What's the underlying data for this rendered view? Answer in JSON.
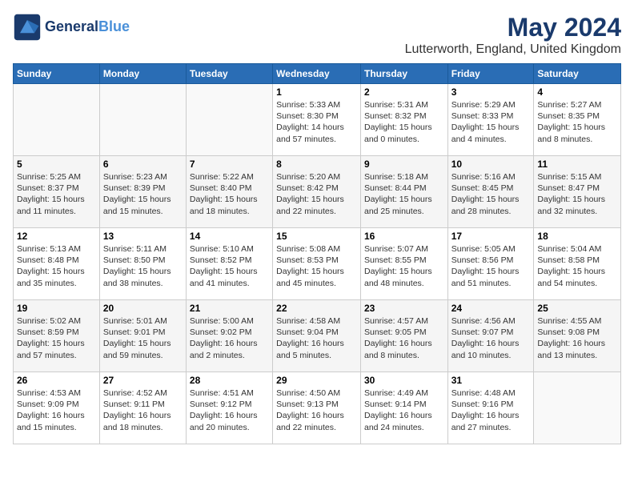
{
  "header": {
    "logo_line1": "General",
    "logo_line2": "Blue",
    "month_title": "May 2024",
    "location": "Lutterworth, England, United Kingdom"
  },
  "days_of_week": [
    "Sunday",
    "Monday",
    "Tuesday",
    "Wednesday",
    "Thursday",
    "Friday",
    "Saturday"
  ],
  "weeks": [
    [
      {
        "day": "",
        "info": ""
      },
      {
        "day": "",
        "info": ""
      },
      {
        "day": "",
        "info": ""
      },
      {
        "day": "1",
        "info": "Sunrise: 5:33 AM\nSunset: 8:30 PM\nDaylight: 14 hours\nand 57 minutes."
      },
      {
        "day": "2",
        "info": "Sunrise: 5:31 AM\nSunset: 8:32 PM\nDaylight: 15 hours\nand 0 minutes."
      },
      {
        "day": "3",
        "info": "Sunrise: 5:29 AM\nSunset: 8:33 PM\nDaylight: 15 hours\nand 4 minutes."
      },
      {
        "day": "4",
        "info": "Sunrise: 5:27 AM\nSunset: 8:35 PM\nDaylight: 15 hours\nand 8 minutes."
      }
    ],
    [
      {
        "day": "5",
        "info": "Sunrise: 5:25 AM\nSunset: 8:37 PM\nDaylight: 15 hours\nand 11 minutes."
      },
      {
        "day": "6",
        "info": "Sunrise: 5:23 AM\nSunset: 8:39 PM\nDaylight: 15 hours\nand 15 minutes."
      },
      {
        "day": "7",
        "info": "Sunrise: 5:22 AM\nSunset: 8:40 PM\nDaylight: 15 hours\nand 18 minutes."
      },
      {
        "day": "8",
        "info": "Sunrise: 5:20 AM\nSunset: 8:42 PM\nDaylight: 15 hours\nand 22 minutes."
      },
      {
        "day": "9",
        "info": "Sunrise: 5:18 AM\nSunset: 8:44 PM\nDaylight: 15 hours\nand 25 minutes."
      },
      {
        "day": "10",
        "info": "Sunrise: 5:16 AM\nSunset: 8:45 PM\nDaylight: 15 hours\nand 28 minutes."
      },
      {
        "day": "11",
        "info": "Sunrise: 5:15 AM\nSunset: 8:47 PM\nDaylight: 15 hours\nand 32 minutes."
      }
    ],
    [
      {
        "day": "12",
        "info": "Sunrise: 5:13 AM\nSunset: 8:48 PM\nDaylight: 15 hours\nand 35 minutes."
      },
      {
        "day": "13",
        "info": "Sunrise: 5:11 AM\nSunset: 8:50 PM\nDaylight: 15 hours\nand 38 minutes."
      },
      {
        "day": "14",
        "info": "Sunrise: 5:10 AM\nSunset: 8:52 PM\nDaylight: 15 hours\nand 41 minutes."
      },
      {
        "day": "15",
        "info": "Sunrise: 5:08 AM\nSunset: 8:53 PM\nDaylight: 15 hours\nand 45 minutes."
      },
      {
        "day": "16",
        "info": "Sunrise: 5:07 AM\nSunset: 8:55 PM\nDaylight: 15 hours\nand 48 minutes."
      },
      {
        "day": "17",
        "info": "Sunrise: 5:05 AM\nSunset: 8:56 PM\nDaylight: 15 hours\nand 51 minutes."
      },
      {
        "day": "18",
        "info": "Sunrise: 5:04 AM\nSunset: 8:58 PM\nDaylight: 15 hours\nand 54 minutes."
      }
    ],
    [
      {
        "day": "19",
        "info": "Sunrise: 5:02 AM\nSunset: 8:59 PM\nDaylight: 15 hours\nand 57 minutes."
      },
      {
        "day": "20",
        "info": "Sunrise: 5:01 AM\nSunset: 9:01 PM\nDaylight: 15 hours\nand 59 minutes."
      },
      {
        "day": "21",
        "info": "Sunrise: 5:00 AM\nSunset: 9:02 PM\nDaylight: 16 hours\nand 2 minutes."
      },
      {
        "day": "22",
        "info": "Sunrise: 4:58 AM\nSunset: 9:04 PM\nDaylight: 16 hours\nand 5 minutes."
      },
      {
        "day": "23",
        "info": "Sunrise: 4:57 AM\nSunset: 9:05 PM\nDaylight: 16 hours\nand 8 minutes."
      },
      {
        "day": "24",
        "info": "Sunrise: 4:56 AM\nSunset: 9:07 PM\nDaylight: 16 hours\nand 10 minutes."
      },
      {
        "day": "25",
        "info": "Sunrise: 4:55 AM\nSunset: 9:08 PM\nDaylight: 16 hours\nand 13 minutes."
      }
    ],
    [
      {
        "day": "26",
        "info": "Sunrise: 4:53 AM\nSunset: 9:09 PM\nDaylight: 16 hours\nand 15 minutes."
      },
      {
        "day": "27",
        "info": "Sunrise: 4:52 AM\nSunset: 9:11 PM\nDaylight: 16 hours\nand 18 minutes."
      },
      {
        "day": "28",
        "info": "Sunrise: 4:51 AM\nSunset: 9:12 PM\nDaylight: 16 hours\nand 20 minutes."
      },
      {
        "day": "29",
        "info": "Sunrise: 4:50 AM\nSunset: 9:13 PM\nDaylight: 16 hours\nand 22 minutes."
      },
      {
        "day": "30",
        "info": "Sunrise: 4:49 AM\nSunset: 9:14 PM\nDaylight: 16 hours\nand 24 minutes."
      },
      {
        "day": "31",
        "info": "Sunrise: 4:48 AM\nSunset: 9:16 PM\nDaylight: 16 hours\nand 27 minutes."
      },
      {
        "day": "",
        "info": ""
      }
    ]
  ]
}
